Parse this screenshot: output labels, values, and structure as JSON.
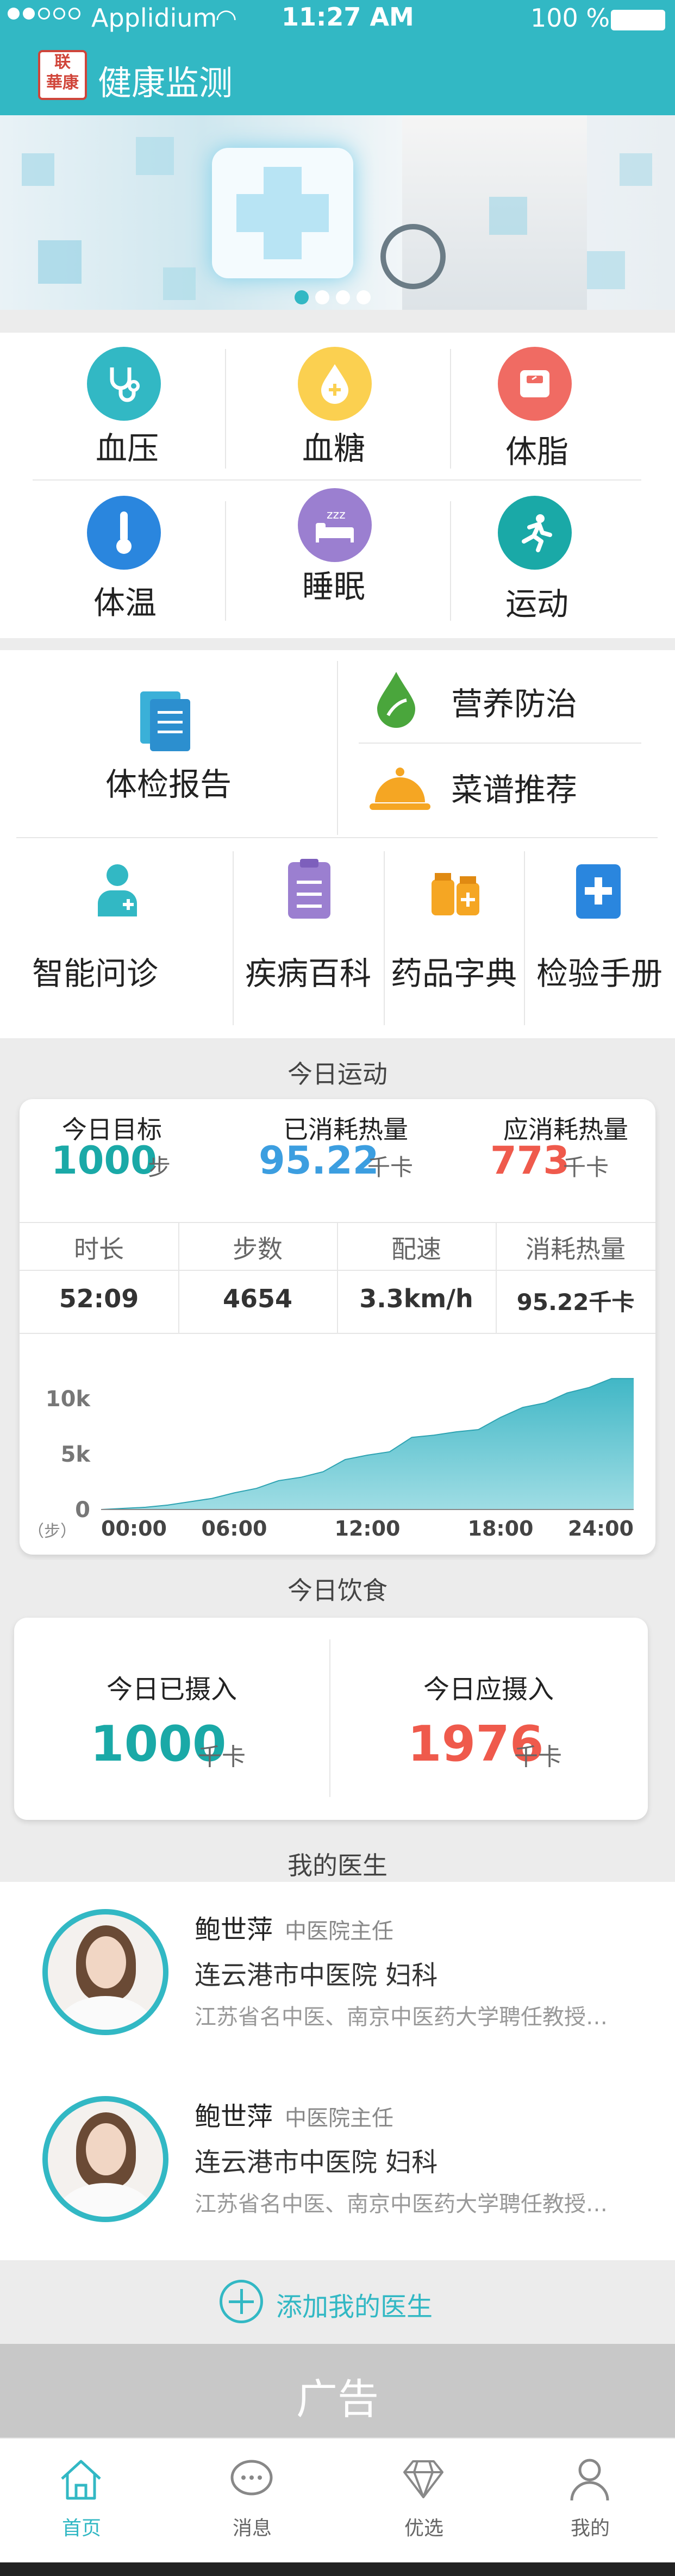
{
  "status_bar": {
    "carrier": "Applidium",
    "time": "11:27 AM",
    "battery": "100 %"
  },
  "header": {
    "logo_text": "联\n華康",
    "title": "健康监测"
  },
  "colors": {
    "brand": "#32b8c4",
    "blue": "#3c9ee0",
    "red": "#ef5a4c",
    "orange": "#f5a623",
    "gray_bg": "#ececec"
  },
  "monitor": {
    "items": [
      {
        "label": "血压",
        "icon": "stethoscope-icon",
        "color": "#32b8c4"
      },
      {
        "label": "血糖",
        "icon": "blood-drop-icon",
        "color": "#fbd050"
      },
      {
        "label": "体脂",
        "icon": "scale-icon",
        "color": "#f06b63"
      },
      {
        "label": "体温",
        "icon": "thermometer-icon",
        "color": "#2a86de"
      },
      {
        "label": "睡眠",
        "icon": "sleep-icon",
        "color": "#9b7fd0"
      },
      {
        "label": "运动",
        "icon": "run-icon",
        "color": "#1aa9a7"
      }
    ]
  },
  "services": {
    "report": "体检报告",
    "nutrition": "营养防治",
    "recipe": "菜谱推荐",
    "row2": [
      "智能问诊",
      "疾病百科",
      "药品字典",
      "检验手册"
    ]
  },
  "exercise": {
    "section_title": "今日运动",
    "goal_label": "今日目标",
    "goal_value": "1000",
    "goal_unit": "步",
    "burned_label": "已消耗热量",
    "burned_value": "95.22",
    "burned_unit": "千卡",
    "should_label": "应消耗热量",
    "should_value": "773",
    "should_unit": "千卡",
    "table_headers": [
      "时长",
      "步数",
      "配速",
      "消耗热量"
    ],
    "table_values": [
      "52:09",
      "4654",
      "3.3km/h",
      "95.22千卡"
    ]
  },
  "chart_data": {
    "type": "area",
    "ylabel": "（步）",
    "y_ticks": [
      "10k",
      "5k",
      "0"
    ],
    "ylim": [
      0,
      12000
    ],
    "x_ticks": [
      "00:00",
      "06:00",
      "12:00",
      "18:00",
      "24:00"
    ],
    "x": [
      0,
      2,
      3,
      4,
      5,
      6,
      7,
      8,
      9,
      10,
      11,
      12,
      13,
      14,
      15,
      16,
      17,
      18,
      19,
      20,
      21,
      22,
      23,
      24
    ],
    "values": [
      0,
      200,
      400,
      700,
      1000,
      1500,
      1900,
      2600,
      2900,
      3400,
      4500,
      4900,
      5200,
      6500,
      6700,
      7000,
      7200,
      8300,
      9200,
      9600,
      10500,
      11000,
      11800,
      11800
    ],
    "color": "#41b7c6",
    "grid": false
  },
  "diet": {
    "section_title": "今日饮食",
    "taken_label": "今日已摄入",
    "taken_value": "1000",
    "taken_unit": "千卡",
    "should_label": "今日应摄入",
    "should_value": "1976",
    "should_unit": "千卡"
  },
  "doctors": {
    "section_title": "我的医生",
    "list": [
      {
        "name": "鲍世萍",
        "title": "中医院主任",
        "hospital": "连云港市中医院 妇科",
        "desc": "江苏省名中医、南京中医药大学聘任教授…"
      },
      {
        "name": "鲍世萍",
        "title": "中医院主任",
        "hospital": "连云港市中医院 妇科",
        "desc": "江苏省名中医、南京中医药大学聘任教授…"
      }
    ],
    "add_label": "添加我的医生"
  },
  "ad": {
    "label": "广告"
  },
  "tabbar": {
    "items": [
      {
        "label": "首页",
        "icon": "home-icon",
        "active": true
      },
      {
        "label": "消息",
        "icon": "message-icon",
        "active": false
      },
      {
        "label": "优选",
        "icon": "diamond-icon",
        "active": false
      },
      {
        "label": "我的",
        "icon": "profile-icon",
        "active": false
      }
    ]
  }
}
